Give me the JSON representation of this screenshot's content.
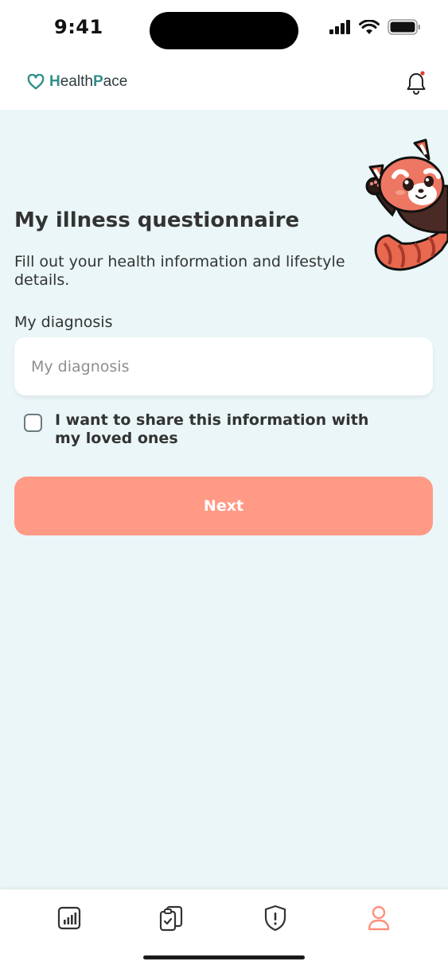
{
  "status_bar": {
    "time": "9:41"
  },
  "header": {
    "logo_h": "H",
    "logo_ealth": "ealth",
    "logo_p": "P",
    "logo_ace": "ace",
    "notification_dot_color": "#e53935"
  },
  "main": {
    "title": "My illness questionnaire",
    "subtitle": "Fill out your health information and lifestyle details.",
    "diagnosis_label": "My diagnosis",
    "diagnosis_value": "",
    "diagnosis_placeholder": "My diagnosis",
    "share_checked": false,
    "share_label": "I want to share this information with my loved ones",
    "next_label": "Next"
  },
  "tab_bar": {
    "tabs": [
      {
        "icon": "stats-chart-icon",
        "active": false
      },
      {
        "icon": "clipboard-check-icon",
        "active": false
      },
      {
        "icon": "shield-alert-icon",
        "active": false
      },
      {
        "icon": "profile-icon",
        "active": true
      }
    ]
  },
  "colors": {
    "brand_teal": "#2f8f8a",
    "background": "#eaf6f7",
    "primary_button": "#ff9a86",
    "active_tab": "#ff8f7a"
  }
}
